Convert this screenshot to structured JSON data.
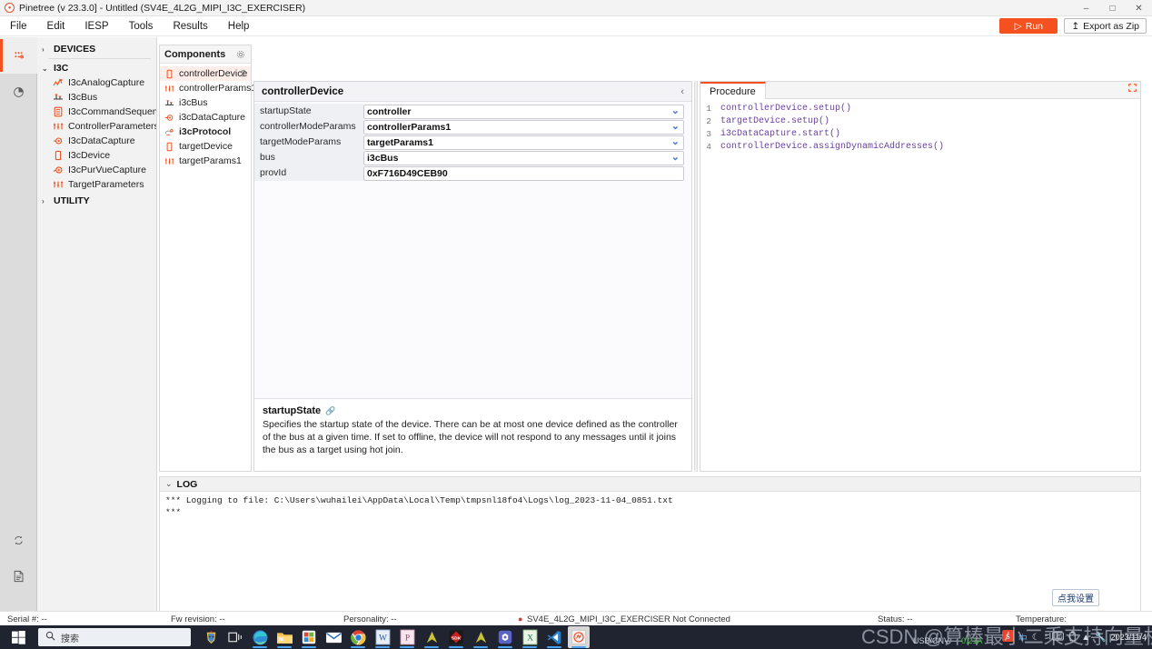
{
  "window": {
    "title": "Pinetree (v 23.3.0] - Untitled (SV4E_4L2G_MIPI_I3C_EXERCISER)",
    "app_icon": "pinetree-logo-icon",
    "minimize": "–",
    "maximize": "□",
    "close": "✕"
  },
  "menubar": {
    "items": [
      {
        "label": "File"
      },
      {
        "label": "Edit"
      },
      {
        "label": "IESP"
      },
      {
        "label": "Tools"
      },
      {
        "label": "Results"
      },
      {
        "label": "Help"
      }
    ],
    "run_label": "Run",
    "export_label": "Export as Zip"
  },
  "rail": {
    "items": [
      {
        "name": "i3c-exerciser-icon",
        "active": true
      },
      {
        "name": "analytics-icon",
        "active": false
      }
    ],
    "bottom_items": [
      {
        "name": "refresh-icon"
      },
      {
        "name": "document-icon"
      }
    ]
  },
  "tree": {
    "groups": [
      {
        "label": "DEVICES",
        "expanded": false,
        "caret": "›",
        "children": []
      },
      {
        "label": "I3C",
        "expanded": true,
        "caret": "⌄",
        "children": [
          {
            "label": "I3cAnalogCapture",
            "icon": "analog-capture-icon"
          },
          {
            "label": "I3cBus",
            "icon": "bus-icon"
          },
          {
            "label": "I3cCommandSequen...",
            "icon": "command-sequence-icon"
          },
          {
            "label": "ControllerParameters",
            "icon": "parameters-icon"
          },
          {
            "label": "I3cDataCapture",
            "icon": "data-capture-icon"
          },
          {
            "label": "I3cDevice",
            "icon": "device-icon"
          },
          {
            "label": "I3cPurVueCapture",
            "icon": "purvue-capture-icon"
          },
          {
            "label": "TargetParameters",
            "icon": "parameters-icon"
          }
        ]
      },
      {
        "label": "UTILITY",
        "expanded": false,
        "caret": "›",
        "children": []
      }
    ]
  },
  "components": {
    "title": "Components",
    "gear_icon": "gear-icon",
    "items": [
      {
        "label": "controllerDevice",
        "icon": "device-icon",
        "selected": true,
        "bold": false,
        "trash": "🗑"
      },
      {
        "label": "controllerParams1",
        "icon": "parameters-icon",
        "selected": false,
        "bold": false
      },
      {
        "label": "i3cBus",
        "icon": "bus-icon",
        "selected": false,
        "bold": false
      },
      {
        "label": "i3cDataCapture",
        "icon": "data-capture-icon",
        "selected": false,
        "bold": false
      },
      {
        "label": "i3cProtocol",
        "icon": "protocol-icon",
        "selected": false,
        "bold": true
      },
      {
        "label": "targetDevice",
        "icon": "device-icon",
        "selected": false,
        "bold": false
      },
      {
        "label": "targetParams1",
        "icon": "parameters-icon",
        "selected": false,
        "bold": false
      }
    ]
  },
  "properties": {
    "title": "controllerDevice",
    "collapse_icon": "chevron-left-icon",
    "rows": [
      {
        "name": "startupState",
        "value": "controller",
        "dropdown": true
      },
      {
        "name": "controllerModeParams",
        "value": "controllerParams1",
        "dropdown": true
      },
      {
        "name": "targetModeParams",
        "value": "targetParams1",
        "dropdown": true
      },
      {
        "name": "bus",
        "value": "i3cBus",
        "dropdown": true
      },
      {
        "name": "provId",
        "value": "0xF716D49CEB90",
        "dropdown": false
      }
    ],
    "description": {
      "title": "startupState",
      "link_icon": "link-icon",
      "text": "Specifies the startup state of the device. There can be at most one device defined as the controller of the bus at a given time. If set to offline, the device will not respond to any messages until it joins the bus as a target using hot join."
    }
  },
  "procedure": {
    "tab_label": "Procedure",
    "expand_icon": "expand-icon",
    "lines": [
      {
        "num": "1",
        "text": "controllerDevice.setup()"
      },
      {
        "num": "2",
        "text": "targetDevice.setup()"
      },
      {
        "num": "3",
        "text": "i3cDataCapture.start()"
      },
      {
        "num": "4",
        "text": "controllerDevice.assignDynamicAddresses()"
      }
    ]
  },
  "log": {
    "title": "LOG",
    "caret": "⌄",
    "lines": [
      "*** Logging to file: C:\\Users\\wuhailei\\AppData\\Local\\Temp\\tmpsnl18fo4\\Logs\\log_2023-11-04_0851.txt",
      "***"
    ]
  },
  "tooltip": {
    "text": "点我设置"
  },
  "statusbar": {
    "serial": "Serial #:  --",
    "fw": "Fw revision: --",
    "personality": "Personality: --",
    "device": "SV4E_4L2G_MIPI_I3C_EXERCISER Not Connected",
    "device_dot_color": "#e03a2f",
    "status": "Status: --",
    "temperature": "Temperature:"
  },
  "taskbar": {
    "start_icon": "windows-start-icon",
    "search_placeholder": "搜索",
    "search_icon": "search-icon",
    "icons": [
      {
        "name": "egypt-mask-icon"
      },
      {
        "name": "task-view-icon"
      },
      {
        "name": "edge-icon",
        "running": true
      },
      {
        "name": "file-explorer-icon",
        "running": true
      },
      {
        "name": "microsoft-store-icon",
        "running": true
      },
      {
        "name": "mail-icon"
      },
      {
        "name": "chrome-icon",
        "running": true
      },
      {
        "name": "word-icon",
        "running": true
      },
      {
        "name": "powerpoint-icon",
        "running": true
      },
      {
        "name": "acrobat-icon",
        "running": true
      },
      {
        "name": "sdk-icon",
        "running": true
      },
      {
        "name": "acrobat2-icon",
        "running": true
      },
      {
        "name": "teams-icon",
        "running": true
      },
      {
        "name": "excel-icon",
        "running": true
      },
      {
        "name": "vscode-icon",
        "running": true
      },
      {
        "name": "pinetree-icon",
        "running": true,
        "active": true
      }
    ],
    "tray": {
      "items": [
        "sogou-icon",
        "ime-cn-icon",
        "moon-icon",
        "degree-icon",
        "keyboard-icon",
        "battery-icon",
        "up-arrow-icon",
        "wrench-icon"
      ],
      "clock_time": "",
      "clock_date": "2023/11/4"
    }
  },
  "watermark": {
    "text": "CSDN @算棒最小二乘支持向量机",
    "usb": "USB/CNV",
    "green": "0.21A"
  }
}
